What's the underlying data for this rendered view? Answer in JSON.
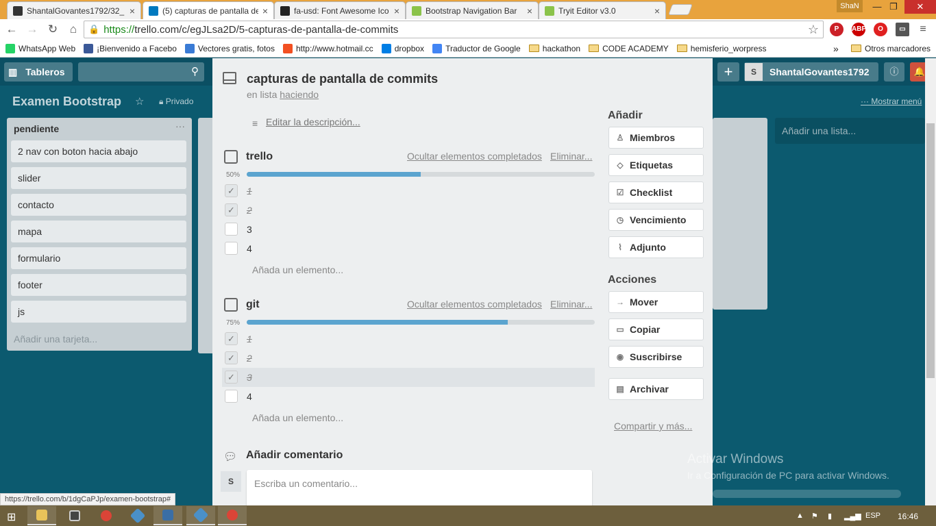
{
  "browser": {
    "tabs": [
      {
        "title": "ShantalGovantes1792/32_",
        "color": "#333333",
        "active": false
      },
      {
        "title": "(5) capturas de pantalla de",
        "color": "#0079bf",
        "active": true
      },
      {
        "title": "fa-usd: Font Awesome Ico",
        "color": "#222222",
        "active": false
      },
      {
        "title": "Bootstrap Navigation Bar",
        "color": "#8bc34a",
        "active": false
      },
      {
        "title": "Tryit Editor v3.0",
        "color": "#8bc34a",
        "active": false
      }
    ],
    "profile": "ShaN",
    "url_scheme": "https://",
    "url_rest": "trello.com/c/egJLsa2D/5-capturas-de-pantalla-de-commits",
    "bookmarks": [
      {
        "label": "WhatsApp Web",
        "color": "#25d366",
        "folder": false
      },
      {
        "label": "¡Bienvenido a Facebo",
        "color": "#3b5998",
        "folder": false
      },
      {
        "label": "Vectores gratis, fotos",
        "color": "#3a7bd5",
        "folder": false
      },
      {
        "label": "http://www.hotmail.cc",
        "color": "#f25022",
        "folder": false
      },
      {
        "label": "dropbox",
        "color": "#007ee5",
        "folder": false
      },
      {
        "label": "Traductor de Google",
        "color": "#4285f4",
        "folder": false
      },
      {
        "label": "hackathon",
        "color": "",
        "folder": true
      },
      {
        "label": "CODE ACADEMY",
        "color": "",
        "folder": true
      },
      {
        "label": "hemisferio_worpress",
        "color": "",
        "folder": true
      }
    ],
    "bookmarks_more": "»",
    "other_bookmarks": "Otros marcadores",
    "status_url": "https://trello.com/b/1dgCaPJp/examen-bootstrap#"
  },
  "trello": {
    "boards_label": "Tableros",
    "user_initial": "S",
    "username": "ShantalGovantes1792",
    "board_title": "Examen Bootstrap",
    "privacy": "Privado",
    "show_menu": "Mostrar menú",
    "list1": {
      "title": "pendiente",
      "cards": [
        "2 nav con boton hacia abajo",
        "slider",
        "contacto",
        "mapa",
        "formulario",
        "footer",
        "js"
      ],
      "add_card": "Añadir una tarjeta..."
    },
    "add_list": "Añadir una lista..."
  },
  "modal": {
    "title": "capturas de pantalla de commits",
    "in_list_prefix": "en lista",
    "list_name": "haciendo",
    "edit_description": "Editar la descripción...",
    "hide_completed": "Ocultar elementos completados",
    "delete": "Eliminar...",
    "add_item": "Añada un elemento...",
    "checklists": [
      {
        "title": "trello",
        "percent_label": "50%",
        "progress": 0.5,
        "items": [
          {
            "text": "1",
            "done": true
          },
          {
            "text": "2",
            "done": true
          },
          {
            "text": "3",
            "done": false
          },
          {
            "text": "4",
            "done": false
          }
        ]
      },
      {
        "title": "git",
        "percent_label": "75%",
        "progress": 0.75,
        "items": [
          {
            "text": "1",
            "done": true
          },
          {
            "text": "2",
            "done": true
          },
          {
            "text": "3",
            "done": true
          },
          {
            "text": "4",
            "done": false
          }
        ]
      }
    ],
    "add_heading": "Añadir",
    "add_buttons": [
      {
        "label": "Miembros",
        "icon": "person-icon",
        "glyph": "♙"
      },
      {
        "label": "Etiquetas",
        "icon": "tag-icon",
        "glyph": "◇"
      },
      {
        "label": "Checklist",
        "icon": "checklist-icon",
        "glyph": "☑"
      },
      {
        "label": "Vencimiento",
        "icon": "clock-icon",
        "glyph": "◷"
      },
      {
        "label": "Adjunto",
        "icon": "paperclip-icon",
        "glyph": "⌇"
      }
    ],
    "actions_heading": "Acciones",
    "action_buttons": [
      {
        "label": "Mover",
        "icon": "arrow-right-icon",
        "glyph": "→"
      },
      {
        "label": "Copiar",
        "icon": "copy-icon",
        "glyph": "▭"
      },
      {
        "label": "Suscribirse",
        "icon": "eye-icon",
        "glyph": "◉"
      }
    ],
    "archive_button": {
      "label": "Archivar",
      "icon": "archive-icon",
      "glyph": "▤"
    },
    "share_more": "Compartir y más...",
    "comment_heading": "Añadir comentario",
    "comment_avatar": "S",
    "comment_placeholder": "Escriba un comentario..."
  },
  "windows": {
    "activate_title": "Activar Windows",
    "activate_sub": "Ir a Configuración de PC para activar Windows.",
    "language": "ESP",
    "time": "16:46"
  }
}
